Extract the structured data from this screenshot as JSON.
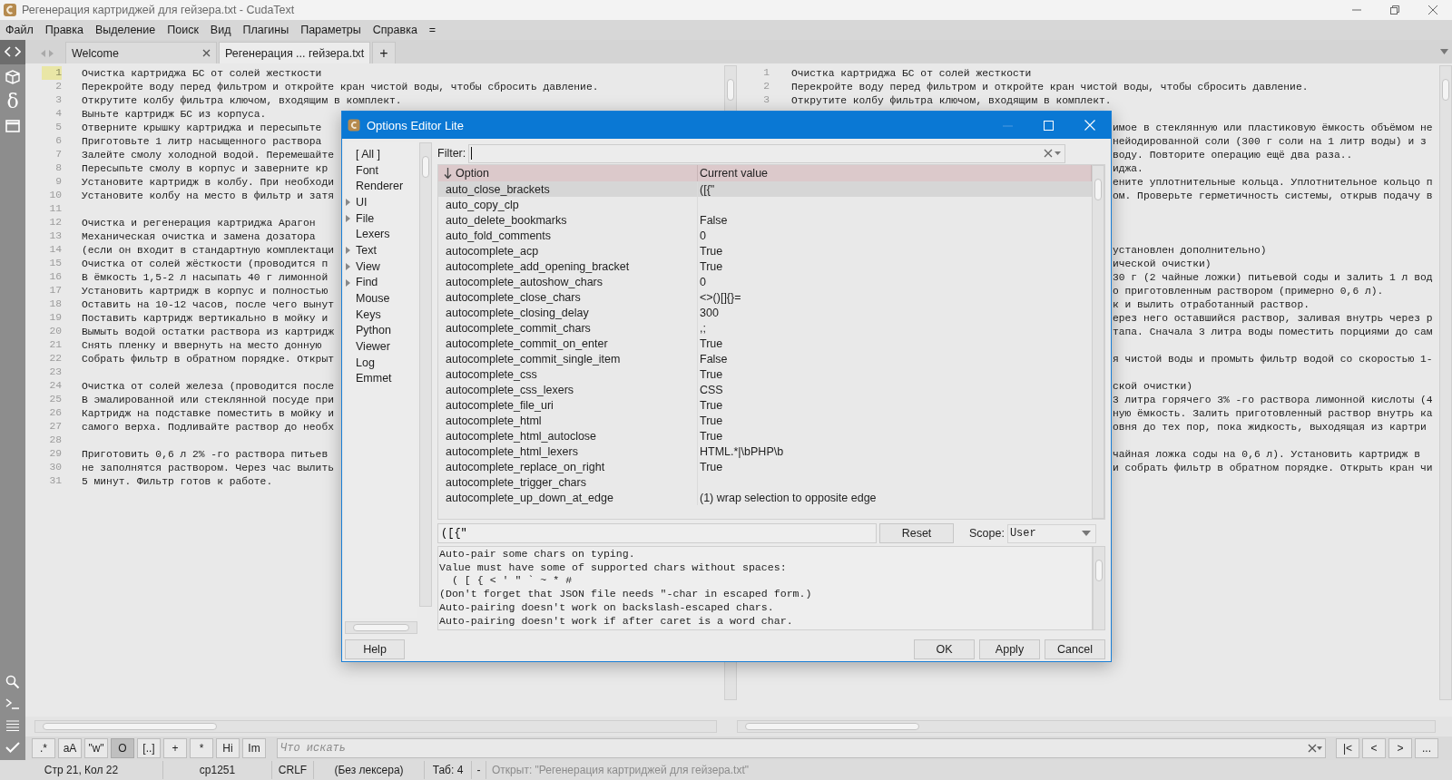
{
  "window": {
    "title": "Регенерация картриджей для гейзера.txt - CudaText"
  },
  "menu": [
    "Файл",
    "Правка",
    "Выделение",
    "Поиск",
    "Вид",
    "Плагины",
    "Параметры",
    "Справка",
    "="
  ],
  "sidebar": {
    "top": [
      {
        "kind": "code",
        "selected": true
      },
      {
        "kind": "cube",
        "selected": false
      },
      {
        "kind": "glyph",
        "text": "δ",
        "selected": false
      },
      {
        "kind": "panel",
        "selected": false
      }
    ],
    "bottom": [
      {
        "kind": "search"
      },
      {
        "kind": "terminal"
      },
      {
        "kind": "list"
      },
      {
        "kind": "check"
      }
    ]
  },
  "tabs": [
    {
      "label": "Welcome",
      "selected": false
    },
    {
      "label": "Регенерация ... гейзера.txt",
      "selected": true
    }
  ],
  "new_tab": "+",
  "editor": {
    "left_lines": [
      {
        "num": "1",
        "current": true,
        "text": "Очистка картриджа БС от солей жесткости"
      },
      {
        "num": "2",
        "current": false,
        "text": "Перекройте воду перед фильтром и откройте кран чистой воды, чтобы сбросить давление."
      },
      {
        "num": "3",
        "current": false,
        "text": "Открутите колбу фильтра ключом, входящим в комплект."
      },
      {
        "num": "4",
        "current": false,
        "text": "Выньте картридж БС из корпуса."
      },
      {
        "num": "5",
        "current": false,
        "text": "Отверните крышку картриджа и пересыпьте"
      },
      {
        "num": "6",
        "current": false,
        "text": "Приготовьте 1 литр насыщенного раствора"
      },
      {
        "num": "7",
        "current": false,
        "text": "Залейте смолу холодной водой. Перемешайте"
      },
      {
        "num": "8",
        "current": false,
        "text": "Пересыпьте смолу в корпус и заверните кр"
      },
      {
        "num": "9",
        "current": false,
        "text": "Установите картридж в колбу. При необходи"
      },
      {
        "num": "10",
        "current": false,
        "text": "Установите колбу на место в фильтр и затя"
      },
      {
        "num": "11",
        "current": false
      },
      {
        "num": "12",
        "current": false,
        "text": "Очистка и регенерация картриджа Арагон"
      },
      {
        "num": "13",
        "current": false,
        "text": "Механическая очистка и замена дозатора"
      },
      {
        "num": "14",
        "current": false,
        "text": "(если он входит в стандартную комплектаци"
      },
      {
        "num": "15",
        "current": false,
        "text": "Очистка от солей жёсткости (проводится п"
      },
      {
        "num": "16",
        "current": false,
        "text": "В ёмкость 1,5-2 л насыпать 40 г лимонной"
      },
      {
        "num": "17",
        "current": false,
        "text": "Установить картридж в корпус и полностью"
      },
      {
        "num": "18",
        "current": false,
        "text": "Оставить на 10-12 часов, после чего вынут"
      },
      {
        "num": "19",
        "current": false,
        "text": "Поставить картридж вертикально в мойку и"
      },
      {
        "num": "20",
        "current": false,
        "text": "Вымыть водой остатки раствора из картридж"
      },
      {
        "num": "21",
        "current": false,
        "text": "Снять пленку и ввернуть на место донную"
      },
      {
        "num": "22",
        "current": false,
        "text": "Собрать фильтр в обратном порядке. Открыт"
      },
      {
        "num": "23",
        "current": false
      },
      {
        "num": "24",
        "current": false,
        "text": "Очистка от солей железа (проводится после"
      },
      {
        "num": "25",
        "current": false,
        "text": "В эмалированной или стеклянной посуде при"
      },
      {
        "num": "26",
        "current": false,
        "text": "Картридж на подставке поместить в мойку и"
      },
      {
        "num": "27",
        "current": false,
        "text": "самого верха. Подливайте раствор до необх"
      },
      {
        "num": "28",
        "current": false
      },
      {
        "num": "29",
        "current": false,
        "text": "Приготовить 0,6 л 2% -го раствора питьев"
      },
      {
        "num": "30",
        "current": false,
        "text": "не заполнятся раствором. Через час вылить"
      },
      {
        "num": "31",
        "current": false,
        "text": "5 минут. Фильтр готов к работе."
      }
    ],
    "right_lines": [
      {
        "kind": "full",
        "num": "1",
        "text": "Очистка картриджа БС от солей жесткости"
      },
      {
        "kind": "full",
        "num": "2",
        "text": "Перекройте воду перед фильтром и откройте кран чистой воды, чтобы сбросить давление."
      },
      {
        "kind": "full",
        "num": "3",
        "text": "Открутите колбу фильтра ключом, входящим в комплект."
      },
      {
        "kind": "blank"
      },
      {
        "kind": "tail",
        "text": "имое в стеклянную или пластиковую ёмкость объёмом не"
      },
      {
        "kind": "tail",
        "text": "нейодированной соли (300 г соли на 1 литр воды) и з"
      },
      {
        "kind": "tail",
        "text": "воду. Повторите операцию ещё два раза.."
      },
      {
        "kind": "tail",
        "text": "иджа."
      },
      {
        "kind": "tail",
        "text": "ените уплотнительные кольца. Уплотнительное кольцо п"
      },
      {
        "kind": "tail",
        "text": "ом. Проверьте герметичность системы, открыв подачу в"
      },
      {
        "kind": "blank"
      },
      {
        "kind": "blank"
      },
      {
        "kind": "blank"
      },
      {
        "kind": "tail",
        "text": "установлен дополнительно)"
      },
      {
        "kind": "tail",
        "text": "ической очистки)"
      },
      {
        "kind": "tail",
        "text": "30 г (2 чайные ложки) питьевой соды и залить 1 л вод"
      },
      {
        "kind": "tail",
        "text": "о приготовленным раствором (примерно 0,6 л)."
      },
      {
        "kind": "tail",
        "text": "к и вылить отработанный раствор."
      },
      {
        "kind": "tail",
        "text": "ерез него оставшийся раствор, заливая внутрь через р"
      },
      {
        "kind": "tail",
        "text": "тапа. Сначала 3 литра воды поместить порциями до сам"
      },
      {
        "kind": "blank"
      },
      {
        "kind": "tail",
        "text": "я чистой воды и промыть фильтр водой со скоростью 1-"
      },
      {
        "kind": "blank"
      },
      {
        "kind": "tail",
        "text": "ской очистки)"
      },
      {
        "kind": "tail",
        "text": "3 литра горячего 3% -го раствора лимонной кислоты (4"
      },
      {
        "kind": "tail",
        "text": "ную ёмкость. Залить приготовленный раствор внутрь ка"
      },
      {
        "kind": "tail",
        "text": "овня до тех пор, пока жидкость, выходящая из картри"
      },
      {
        "kind": "blank"
      },
      {
        "kind": "tail",
        "text": "чайная ложка соды на 0,6 л). Установить картридж в"
      },
      {
        "kind": "tail",
        "text": "и собрать фильтр в обратном порядке. Открыть кран чи"
      }
    ]
  },
  "find_bar": {
    "options": [
      {
        "label": ".*",
        "on": false
      },
      {
        "label": "aA",
        "on": false
      },
      {
        "label": "\"w\"",
        "on": false
      },
      {
        "label": "O",
        "on": true
      },
      {
        "label": "[..]",
        "on": false
      },
      {
        "label": "+",
        "on": false
      },
      {
        "label": "*",
        "on": false
      },
      {
        "label": "Hi",
        "on": false
      },
      {
        "label": "Im",
        "on": false
      }
    ],
    "placeholder": "Что искать",
    "nav": [
      "|<",
      "<",
      ">",
      "..."
    ]
  },
  "status_bar": {
    "cells": [
      "Стр 21, Кол 22",
      "cp1251",
      "CRLF",
      "(Без лексера)",
      "Таб: 4",
      "-"
    ],
    "message": "Открыт: \"Регенерация картриджей для гейзера.txt\""
  },
  "dialog": {
    "title": "Options Editor Lite",
    "categories": [
      {
        "label": "[ All ]",
        "kind": "leaf"
      },
      {
        "label": "Font",
        "kind": "leaf"
      },
      {
        "label": "Renderer",
        "kind": "leaf"
      },
      {
        "label": "UI",
        "kind": "branch"
      },
      {
        "label": "File",
        "kind": "branch"
      },
      {
        "label": "Lexers",
        "kind": "leaf"
      },
      {
        "label": "Text",
        "kind": "branch"
      },
      {
        "label": "View",
        "kind": "branch"
      },
      {
        "label": "Find",
        "kind": "branch"
      },
      {
        "label": "Mouse",
        "kind": "leaf"
      },
      {
        "label": "Keys",
        "kind": "leaf"
      },
      {
        "label": "Python",
        "kind": "leaf"
      },
      {
        "label": "Viewer",
        "kind": "leaf"
      },
      {
        "label": "Log",
        "kind": "leaf"
      },
      {
        "label": "Emmet",
        "kind": "leaf"
      }
    ],
    "filter_label": "Filter:",
    "columns": [
      "Option",
      "Current value"
    ],
    "rows": [
      {
        "option": "auto_close_brackets",
        "value": "([{\"",
        "selected": true
      },
      {
        "option": "auto_copy_clp",
        "selected": false
      },
      {
        "option": "auto_delete_bookmarks",
        "value": "False",
        "selected": false
      },
      {
        "option": "auto_fold_comments",
        "value": "0",
        "selected": false
      },
      {
        "option": "autocomplete_acp",
        "value": "True",
        "selected": false
      },
      {
        "option": "autocomplete_add_opening_bracket",
        "value": "True",
        "selected": false
      },
      {
        "option": "autocomplete_autoshow_chars",
        "value": "0",
        "selected": false
      },
      {
        "option": "autocomplete_close_chars",
        "value": "<>()[]{}=",
        "selected": false
      },
      {
        "option": "autocomplete_closing_delay",
        "value": "300",
        "selected": false
      },
      {
        "option": "autocomplete_commit_chars",
        "value": ",;",
        "selected": false
      },
      {
        "option": "autocomplete_commit_on_enter",
        "value": "True",
        "selected": false
      },
      {
        "option": "autocomplete_commit_single_item",
        "value": "False",
        "selected": false
      },
      {
        "option": "autocomplete_css",
        "value": "True",
        "selected": false
      },
      {
        "option": "autocomplete_css_lexers",
        "value": "CSS",
        "selected": false
      },
      {
        "option": "autocomplete_file_uri",
        "value": "True",
        "selected": false
      },
      {
        "option": "autocomplete_html",
        "value": "True",
        "selected": false
      },
      {
        "option": "autocomplete_html_autoclose",
        "value": "True",
        "selected": false
      },
      {
        "option": "autocomplete_html_lexers",
        "value": "HTML.*|\\bPHP\\b",
        "selected": false
      },
      {
        "option": "autocomplete_replace_on_right",
        "value": "True",
        "selected": false
      },
      {
        "option": "autocomplete_trigger_chars",
        "selected": false
      },
      {
        "option": "autocomplete_up_down_at_edge",
        "value": "(1) wrap selection to opposite edge",
        "selected": false
      }
    ],
    "value_field": "([{\"",
    "reset": "Reset",
    "scope_label": "Scope:",
    "scope": "User",
    "description": [
      "Auto-pair some chars on typing.",
      "Value must have some of supported chars without spaces:",
      "  ( [ { < ' \" ` ~ * #",
      "(Don't forget that JSON file needs \"-char in escaped form.)",
      "Auto-pairing doesn't work on backslash-escaped chars.",
      "Auto-pairing doesn't work if after caret is a word char."
    ],
    "help": "Help",
    "buttons": [
      "OK",
      "Apply",
      "Cancel"
    ]
  }
}
